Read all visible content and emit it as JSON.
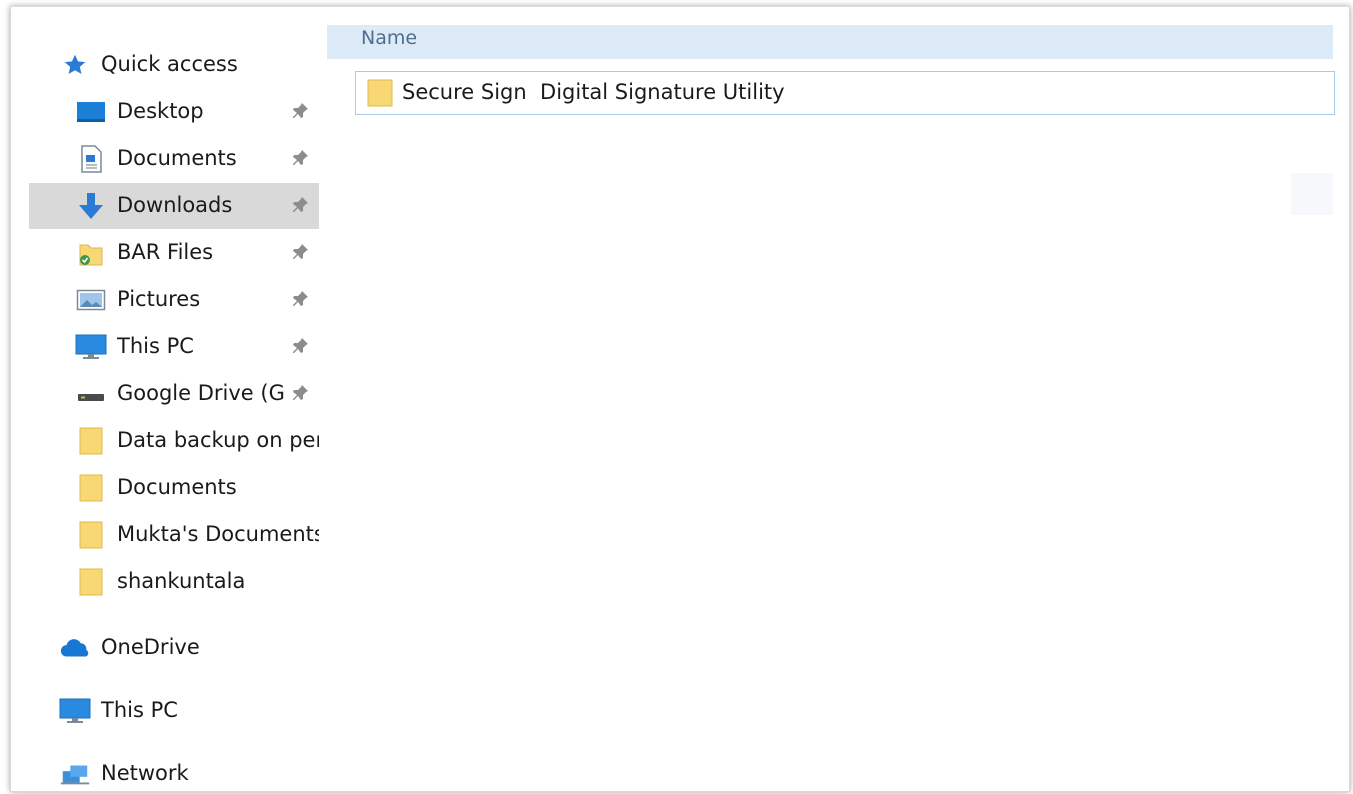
{
  "navigation": {
    "quick_access": {
      "label": "Quick access",
      "icon": "star-icon",
      "icon_color": "#2a7ad6"
    },
    "pinned_items": [
      {
        "label": "Desktop",
        "icon": "desktop-folder-icon",
        "pinned": true
      },
      {
        "label": "Documents",
        "icon": "documents-icon",
        "pinned": true
      },
      {
        "label": "Downloads",
        "icon": "download-arrow-icon",
        "pinned": true,
        "selected": true
      },
      {
        "label": "BAR Files",
        "icon": "shared-folder-icon",
        "pinned": true
      },
      {
        "label": "Pictures",
        "icon": "pictures-icon",
        "pinned": true
      },
      {
        "label": "This PC",
        "icon": "monitor-icon",
        "pinned": true
      },
      {
        "label": "Google Drive (G:",
        "icon": "drive-icon",
        "pinned": true
      },
      {
        "label": "Data backup on per",
        "icon": "folder-icon",
        "pinned": false
      },
      {
        "label": "Documents",
        "icon": "folder-icon",
        "pinned": false
      },
      {
        "label": "Mukta's Documents",
        "icon": "folder-icon",
        "pinned": false
      },
      {
        "label": "shankuntala",
        "icon": "folder-icon",
        "pinned": false
      }
    ],
    "roots": [
      {
        "label": "OneDrive",
        "icon": "cloud-icon"
      },
      {
        "label": "This PC",
        "icon": "monitor-icon"
      },
      {
        "label": "Network",
        "icon": "network-icon"
      }
    ]
  },
  "content": {
    "column_header": "Name",
    "files": [
      {
        "name": "Secure Sign  Digital Signature Utility",
        "type": "folder",
        "icon": "folder-icon"
      }
    ]
  },
  "colors": {
    "selected_bg": "#d9d9d9",
    "header_bg": "#ddebf9",
    "row_border": "#a8cbe9",
    "folder_yellow": "#f8d775"
  }
}
